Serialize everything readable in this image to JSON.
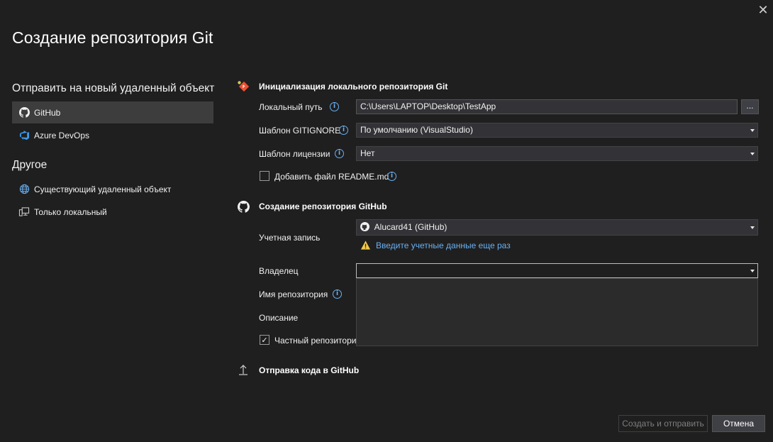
{
  "dialog": {
    "title": "Создание репозитория Git",
    "close_glyph": "✕"
  },
  "sidebar": {
    "push_heading": "Отправить на новый удаленный объект",
    "push_items": [
      {
        "label": "GitHub",
        "icon": "github-icon",
        "selected": true
      },
      {
        "label": "Azure DevOps",
        "icon": "azure-devops-icon",
        "selected": false
      }
    ],
    "other_heading": "Другое",
    "other_items": [
      {
        "label": "Существующий удаленный объект",
        "icon": "globe-icon"
      },
      {
        "label": "Только локальный",
        "icon": "local-computer-icon"
      }
    ]
  },
  "local_repo": {
    "heading": "Инициализация локального репозитория Git",
    "path_label": "Локальный путь",
    "path_value": "C:\\Users\\LAPTOP\\Desktop\\TestApp",
    "browse_label": "...",
    "gitignore_label": "Шаблон GITIGNORE",
    "gitignore_value": "По умолчанию (VisualStudio)",
    "license_label": "Шаблон лицензии",
    "license_value": "Нет",
    "readme_label": "Добавить файл README.md",
    "readme_checked": false
  },
  "github_repo": {
    "heading": "Создание репозитория GitHub",
    "account_label": "Учетная запись",
    "account_value": "Alucard41 (GitHub)",
    "warning_text": "Введите учетные данные еще раз",
    "owner_label": "Владелец",
    "owner_value": "",
    "repo_name_label": "Имя репозитория",
    "description_label": "Описание",
    "private_label": "Частный репозитори",
    "private_checked": true
  },
  "push": {
    "heading": "Отправка кода в GitHub"
  },
  "footer": {
    "create_label": "Создать и отправить",
    "cancel_label": "Отмена"
  },
  "colors": {
    "background": "#1f1f1f",
    "accent_link": "#6ab0f3",
    "warning": "#f2c94c",
    "git_icon": "#f05133"
  }
}
